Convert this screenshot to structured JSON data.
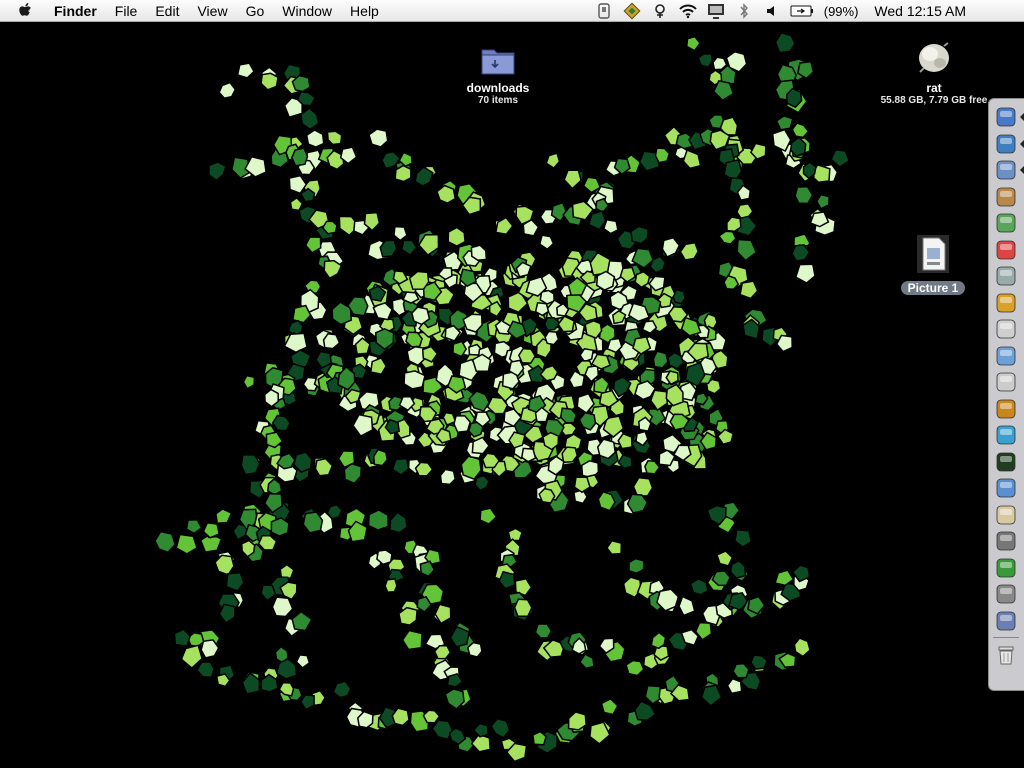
{
  "menubar": {
    "app_name": "Finder",
    "menus": [
      "File",
      "Edit",
      "View",
      "Go",
      "Window",
      "Help"
    ],
    "battery": "(99%)",
    "clock": "Wed 12:15 AM"
  },
  "desktop": {
    "downloads": {
      "name": "downloads",
      "info": "70 items"
    },
    "disk": {
      "name": "rat",
      "info": "55.88 GB, 7.79 GB free"
    },
    "picture": {
      "name": "Picture 1"
    }
  },
  "dock": {
    "items": [
      "finder-icon",
      "network-globe-icon",
      "mail-icon",
      "address-book-icon",
      "itunes-icon",
      "ical-icon",
      "iphoto-icon",
      "console-icon",
      "storage-icon",
      "safari-icon",
      "utility-icon",
      "web-icon",
      "preview-icon",
      "terminal-icon",
      "textedit-icon",
      "script-icon",
      "print-icon",
      "dreamweaver-icon",
      "disk-tool-icon",
      "photo-icon"
    ],
    "trash_icon": "trash-icon"
  },
  "colors": {
    "menubar_bg": "#e9e9e9",
    "desktop_bg": "#000000",
    "wallpaper_green": [
      "#0c4a24",
      "#2f8a32",
      "#63c437",
      "#a6e25f",
      "#dff8c9"
    ],
    "picture_label_bg": "#6f7a86"
  }
}
